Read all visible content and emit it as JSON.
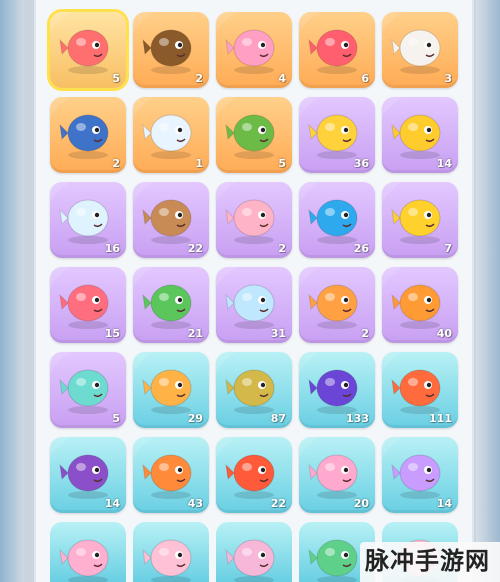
{
  "collection": {
    "rows": [
      [
        {
          "name": "koi-fish",
          "count": "5",
          "bg": "bg-gold",
          "color": "#ff6f6f",
          "selected": true
        },
        {
          "name": "sea-turtles",
          "count": "2",
          "bg": "bg-orange",
          "color": "#8b5a2b"
        },
        {
          "name": "pink-creature",
          "count": "4",
          "bg": "bg-orange",
          "color": "#ff9fc4"
        },
        {
          "name": "red-fish",
          "count": "6",
          "bg": "bg-orange",
          "color": "#ff5f6e"
        },
        {
          "name": "white-seal",
          "count": "3",
          "bg": "bg-orange",
          "color": "#f6f3ee"
        }
      ],
      [
        {
          "name": "shark",
          "count": "2",
          "bg": "bg-orange",
          "color": "#3f72c9"
        },
        {
          "name": "white-whale",
          "count": "1",
          "bg": "bg-orange",
          "color": "#e8f4ff"
        },
        {
          "name": "green-frog",
          "count": "5",
          "bg": "bg-orange",
          "color": "#6dbb47"
        },
        {
          "name": "yellow-pufferfish",
          "count": "36",
          "bg": "bg-purple",
          "color": "#ffd23c"
        },
        {
          "name": "yellow-blowfish",
          "count": "14",
          "bg": "bg-purple",
          "color": "#ffcc2e"
        }
      ],
      [
        {
          "name": "white-spiky-fish",
          "count": "16",
          "bg": "bg-purple",
          "color": "#dff3ff"
        },
        {
          "name": "coconut-creature",
          "count": "22",
          "bg": "bg-purple",
          "color": "#c98b55"
        },
        {
          "name": "pink-axolotl",
          "count": "2",
          "bg": "bg-purple",
          "color": "#ffb3c6"
        },
        {
          "name": "blue-turtle",
          "count": "26",
          "bg": "bg-purple",
          "color": "#2fa9ee"
        },
        {
          "name": "yellow-goldfish",
          "count": "7",
          "bg": "bg-purple",
          "color": "#ffd12c"
        }
      ],
      [
        {
          "name": "starfish",
          "count": "15",
          "bg": "bg-purple",
          "color": "#ff6e7f"
        },
        {
          "name": "green-puffer",
          "count": "21",
          "bg": "bg-purple",
          "color": "#5bc65c"
        },
        {
          "name": "blue-bear",
          "count": "31",
          "bg": "bg-purple",
          "color": "#bfe8ff"
        },
        {
          "name": "orange-platypus",
          "count": "2",
          "bg": "bg-purple",
          "color": "#ffa043"
        },
        {
          "name": "orange-goldfish",
          "count": "40",
          "bg": "bg-purple",
          "color": "#ff9b34"
        }
      ],
      [
        {
          "name": "teal-mouse",
          "count": "5",
          "bg": "bg-purple",
          "color": "#6ddbd0"
        },
        {
          "name": "orange-jellyfish",
          "count": "29",
          "bg": "bg-cyan",
          "color": "#ffb347"
        },
        {
          "name": "yellow-green-fish",
          "count": "87",
          "bg": "bg-cyan",
          "color": "#d3b949"
        },
        {
          "name": "purple-octopus",
          "count": "133",
          "bg": "bg-cyan",
          "color": "#6b46d6"
        },
        {
          "name": "clownfish",
          "count": "111",
          "bg": "bg-cyan",
          "color": "#ff6b3c"
        }
      ],
      [
        {
          "name": "purple-hat-creature",
          "count": "14",
          "bg": "bg-cyan",
          "color": "#8a4fc9"
        },
        {
          "name": "orange-fish",
          "count": "43",
          "bg": "bg-cyan",
          "color": "#ff8a3a"
        },
        {
          "name": "red-striped-fish",
          "count": "22",
          "bg": "bg-cyan",
          "color": "#ff5a3a"
        },
        {
          "name": "pink-blob",
          "count": "20",
          "bg": "bg-cyan",
          "color": "#ffa9cf"
        },
        {
          "name": "purple-crab",
          "count": "14",
          "bg": "bg-cyan",
          "color": "#c99cff"
        }
      ]
    ],
    "partial_row": [
      {
        "name": "pink-fish-partial",
        "bg": "bg-cyan",
        "color": "#ffb0d0"
      },
      {
        "name": "pink-fish-partial-2",
        "bg": "bg-cyan",
        "color": "#ffc1d6"
      },
      {
        "name": "pink-fish-partial-3",
        "bg": "bg-cyan",
        "color": "#f6b7d9"
      },
      {
        "name": "green-fish-partial",
        "bg": "bg-cyan",
        "color": "#5fd08a"
      },
      {
        "name": "pink-fish-partial-4",
        "bg": "bg-cyan",
        "color": "#ffb6cf"
      }
    ]
  },
  "watermark": {
    "text": "脉冲手游网"
  }
}
